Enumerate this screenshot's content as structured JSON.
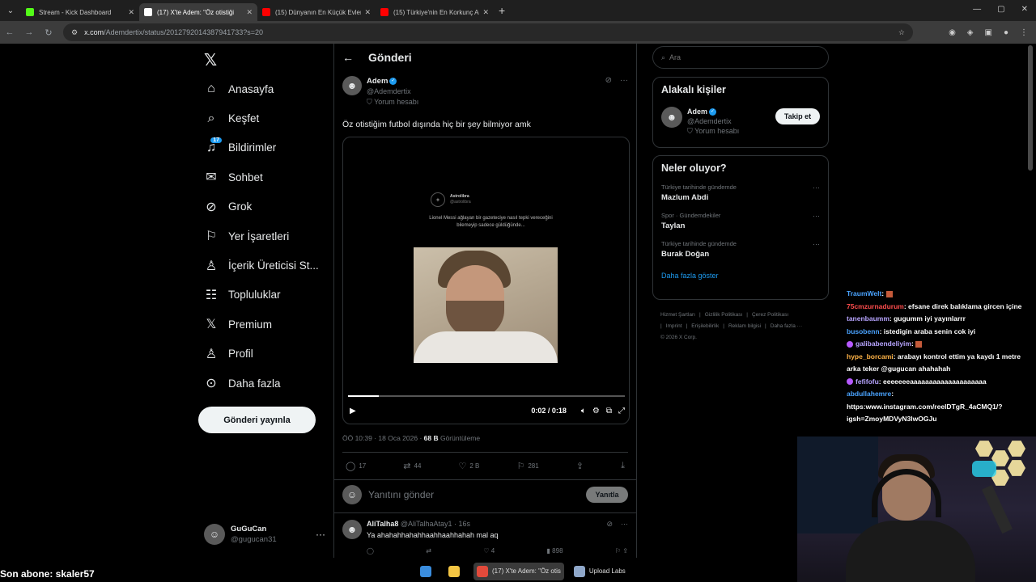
{
  "browser": {
    "tabs": [
      {
        "label": "Stream - Kick Dashboard",
        "icon": "kick-icon",
        "color": "#53fc18",
        "active": false
      },
      {
        "label": "(17) X'te Adem: \"Öz otistiği",
        "icon": "x-icon",
        "color": "#ffffff",
        "active": true
      },
      {
        "label": "(15) Dünyanın En Küçük Evleri:",
        "icon": "youtube-icon",
        "color": "#ff0000",
        "active": false
      },
      {
        "label": "(15) Türkiye'nin En Korkunç Aile",
        "icon": "youtube-icon",
        "color": "#ff0000",
        "active": false
      }
    ],
    "url_host": "x.com",
    "url_path": "/Ademdertix/status/2012792014387941733?s=20"
  },
  "sidebar": {
    "items": [
      {
        "label": "Anasayfa",
        "icon": "home-icon"
      },
      {
        "label": "Keşfet",
        "icon": "search-icon"
      },
      {
        "label": "Bildirimler",
        "icon": "bell-icon",
        "badge": "17"
      },
      {
        "label": "Sohbet",
        "icon": "mail-icon"
      },
      {
        "label": "Grok",
        "icon": "grok-icon"
      },
      {
        "label": "Yer İşaretleri",
        "icon": "bookmark-icon"
      },
      {
        "label": "İçerik Üreticisi St...",
        "icon": "creator-studio-icon"
      },
      {
        "label": "Topluluklar",
        "icon": "communities-icon"
      },
      {
        "label": "Premium",
        "icon": "x-premium-icon"
      },
      {
        "label": "Profil",
        "icon": "profile-icon"
      },
      {
        "label": "Daha fazla",
        "icon": "more-circle-icon"
      }
    ],
    "post_button": "Gönderi yayınla",
    "account": {
      "name": "GuGuCan",
      "handle": "@gugucan31"
    }
  },
  "main": {
    "header_title": "Gönderi",
    "post": {
      "author_name": "Adem",
      "author_handle": "@Ademdertix",
      "author_sub": "Yorum hesabı",
      "text": "Öz otistiğim futbol dışında hiç bir şey bilmiyor amk",
      "media": {
        "embedded_author": "Astrolibra",
        "embedded_handle": "@astrolibra",
        "embedded_text": "Lionel Messi ağlayan bir gazeteciye nasıl tepki vereceğini bilemeyip sadece güldüğünde...",
        "time": "0:02 / 0:18",
        "progress": 0.11
      },
      "timestamp": "ÖÖ 10:39 · 18 Oca 2026 · ",
      "views_count": "68 B",
      "views_label": " Görüntüleme",
      "stats": {
        "replies": "17",
        "reposts": "44",
        "likes": "2 B",
        "bookmarks": "281"
      }
    },
    "reply_box": {
      "placeholder": "Yanıtını gönder",
      "button": "Yanıtla"
    },
    "comment": {
      "name": "AliTalha8",
      "handle": "@AliTalhaAtay1 · 16s",
      "text": "Ya ahahahhahahhaahhaahhahah mal aq",
      "likes": "4",
      "views": "898"
    }
  },
  "right": {
    "search_placeholder": "Ara",
    "related_title": "Alakalı kişiler",
    "related": {
      "name": "Adem",
      "handle": "@Ademdertix",
      "sub": "Yorum hesabı",
      "follow": "Takip et"
    },
    "trends_title": "Neler oluyor?",
    "trends": [
      {
        "context": "Türkiye tarihinde gündemde",
        "topic": "Mazlum Abdi"
      },
      {
        "context": "Spor · Gündemdekiler",
        "topic": "Taylan"
      },
      {
        "context": "Türkiye tarihinde gündemde",
        "topic": "Burak Doğan"
      }
    ],
    "show_more": "Daha fazla göster",
    "footer": [
      "Hizmet Şartları",
      "|",
      "Gizlilik Politikası",
      "|",
      "Çerez Politikası",
      "|",
      "Imprint",
      "|",
      "Erişilebilirlik",
      "|",
      "Reklam bilgisi",
      "|",
      "Daha fazla ···",
      "© 2026 X Corp."
    ]
  },
  "stream_overlay": {
    "chat": [
      {
        "user": "TraumWelt",
        "color": "#4aa3ff",
        "msg": ": ",
        "emote": true
      },
      {
        "user": "75cmzurnadurum",
        "color": "#ff4d4d",
        "msg": ": efsane direk balıklama gircen içine"
      },
      {
        "user": "tanenbaumm",
        "color": "#b7a4ff",
        "msg": ": gugumm iyi yayınlarrr"
      },
      {
        "user": "busobenn",
        "color": "#4aa3ff",
        "msg": ": istedigin araba senin cok iyi"
      },
      {
        "user": "galibabendeliyim",
        "color": "#b7a4ff",
        "msg": ": ",
        "badge": true,
        "emote": true
      },
      {
        "user": "hype_borcami",
        "color": "#ffb347",
        "msg": ": arabayı kontrol ettim ya kaydı 1 metre"
      },
      {
        "user": "",
        "color": "#ffffff",
        "msg": "arka teker @gugucan ahahahah"
      },
      {
        "user": "fefifofu",
        "color": "#b7a4ff",
        "msg": ": eeeeeeeaaaaaaaaaaaaaaaaaaaa",
        "badge": true
      },
      {
        "user": "abdullahemre",
        "color": "#4aa3ff",
        "msg": ":"
      },
      {
        "user": "",
        "color": "#ffffff",
        "msg": "https:www.instagram.com/reelDTgR_4aCMQ1/?"
      },
      {
        "user": "",
        "color": "#ffffff",
        "msg": "igsh=ZmoyMDVyN3lwOGJu"
      }
    ],
    "subscriber_banner": "Son abone: skaler57"
  },
  "taskbar": {
    "items": [
      {
        "label": "",
        "icon": "windows-start-icon",
        "color": "#3a8dde"
      },
      {
        "label": "",
        "icon": "file-explorer-icon",
        "color": "#f3c543"
      },
      {
        "label": "(17) X'te Adem: \"Öz otis",
        "icon": "chrome-icon",
        "color": "#e24a3b",
        "active": true
      },
      {
        "label": "Upload Labs",
        "icon": "upload-labs-icon",
        "color": "#8fa7c9"
      }
    ]
  }
}
